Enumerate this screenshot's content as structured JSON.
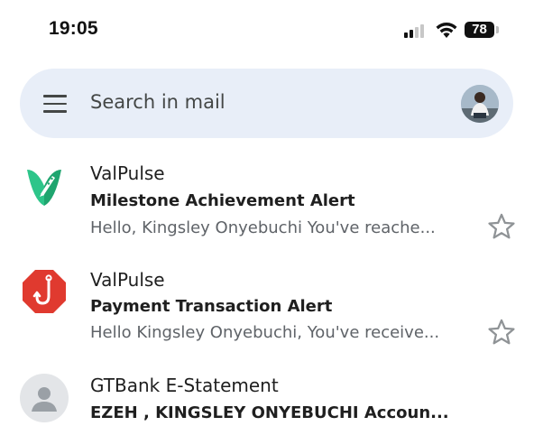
{
  "status_bar": {
    "time": "19:05",
    "battery": "78"
  },
  "search": {
    "placeholder": "Search in mail"
  },
  "emails": [
    {
      "sender": "ValPulse",
      "subject": "Milestone Achievement Alert",
      "snippet": "Hello, Kingsley Onyebuchi You've reache...",
      "icon": "valpulse-logo-icon"
    },
    {
      "sender": "ValPulse",
      "subject": "Payment Transaction Alert",
      "snippet": "Hello Kingsley Onyebuchi, You've receive...",
      "icon": "fishhook-icon"
    },
    {
      "sender": "GTBank E-Statement",
      "subject": "EZEH , KINGSLEY ONYEBUCHI Accoun...",
      "snippet": "",
      "icon": "person-placeholder-icon"
    }
  ],
  "colors": {
    "search_bg": "#e8eef8",
    "valpulse_green": "#2dc58a",
    "alert_red": "#e03a2f",
    "star_gray": "#8f9396"
  }
}
